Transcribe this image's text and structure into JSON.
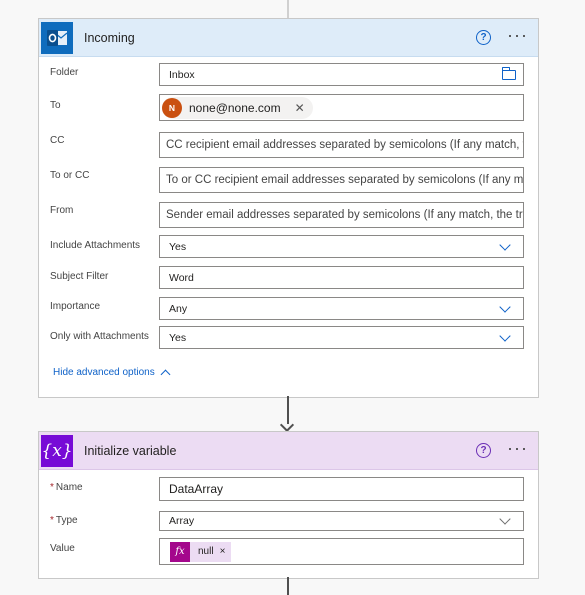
{
  "card1": {
    "title": "Incoming",
    "help": "?",
    "more": "···",
    "fields": {
      "folder": {
        "label": "Folder",
        "value": "Inbox"
      },
      "to": {
        "label": "To",
        "avatar_initial": "N",
        "token": "none@none.com",
        "remove": "✕"
      },
      "cc": {
        "label": "CC",
        "placeholder": "CC recipient email addresses separated by semicolons (If any match, the trigger will run)"
      },
      "to_or_cc": {
        "label": "To or CC",
        "placeholder": "To or CC recipient email addresses separated by semicolons (If any match, the trigger will run)"
      },
      "from": {
        "label": "From",
        "placeholder": "Sender email addresses separated by semicolons (If any match, the trigger will run)"
      },
      "include_attachments": {
        "label": "Include Attachments",
        "value": "Yes"
      },
      "subject_filter": {
        "label": "Subject Filter",
        "value": "Word"
      },
      "importance": {
        "label": "Importance",
        "value": "Any"
      },
      "only_with_attachments": {
        "label": "Only with Attachments",
        "value": "Yes"
      }
    },
    "hide_advanced": "Hide advanced options"
  },
  "card2": {
    "title": "Initialize variable",
    "icon_glyph": "{x}",
    "help": "?",
    "more": "···",
    "fields": {
      "name": {
        "required": "*",
        "label": "Name",
        "value": "DataArray"
      },
      "type": {
        "required": "*",
        "label": "Type",
        "value": "Array"
      },
      "value": {
        "label": "Value",
        "fx": "fx",
        "token": "null",
        "remove": "×"
      }
    }
  },
  "colors": {
    "outlook_blue": "#0f6cbd",
    "header1": "#deecf9",
    "header2": "#ecdcf3",
    "variable_purple": "#770bd6",
    "expression_magenta": "#a4078c",
    "link_blue": "#0f62c8"
  },
  "icons": {
    "card1": "outlook-icon",
    "card2": "variable-icon",
    "folder_picker": "folder-icon",
    "dropdown": "chevron-down-icon",
    "help": "help-icon",
    "more": "more-options-icon"
  }
}
